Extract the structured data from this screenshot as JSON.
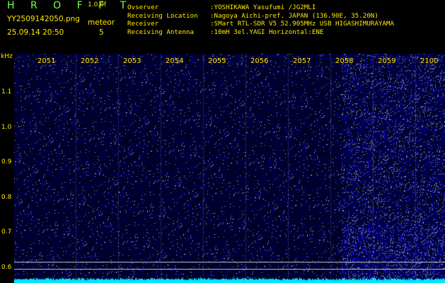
{
  "header": {
    "brand": "H R O F F T",
    "version": "1.0.0f",
    "filename": "YY2509142050.png",
    "datetime": "25.09.14 20:50",
    "count_label": "meteor",
    "count_value": "5"
  },
  "station": [
    {
      "label": "Ovserver",
      "value": ":YOSHIKAWA Yasufumi /JG2MLI"
    },
    {
      "label": "Receiving Location",
      "value": ":Nagoya Aichi-pref. JAPAN (136.90E, 35.20N)"
    },
    {
      "label": "Receiver",
      "value": ":SMart RTL-SDR V5 52.905MHz USB HIGASHIMURAYAMA"
    },
    {
      "label": "Receiving Antenna",
      "value": ":10mH 3el.YAGI Horizontal:ENE"
    }
  ],
  "axes": {
    "y_unit": "kHz",
    "y_ticks": [
      "1.1",
      "1.0",
      "0.9",
      "0.8",
      "0.7",
      "0.6"
    ],
    "x_ticks": [
      "2051",
      "2052",
      "2053",
      "2054",
      "2055",
      "2056",
      "2057",
      "2058",
      "2059",
      "2100"
    ]
  },
  "colors": {
    "label_yellow": "#FFE800",
    "brand_green": "#7CFF4A",
    "noise_blue": "#2a34d8",
    "baseline_cyan": "#00E5FF"
  }
}
